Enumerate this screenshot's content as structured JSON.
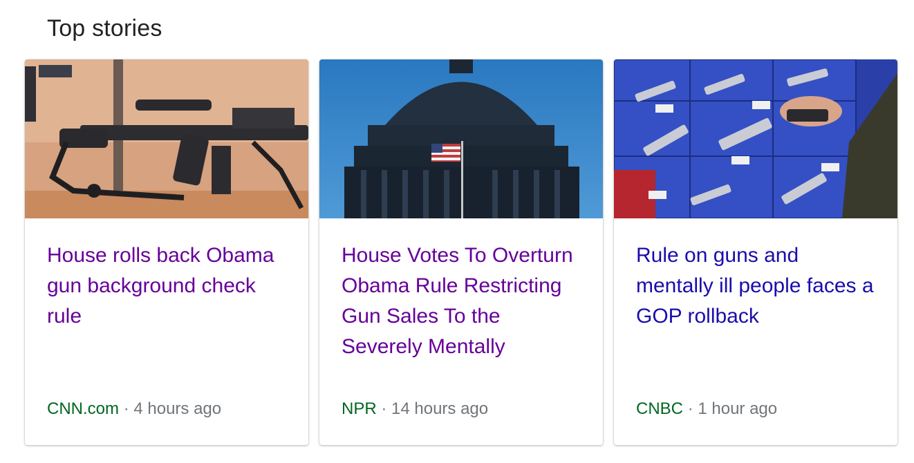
{
  "section": {
    "title": "Top stories"
  },
  "colors": {
    "visited_link": "#660099",
    "link": "#1a0dab",
    "source": "#006621",
    "meta": "#70757a"
  },
  "stories": [
    {
      "headline": "House rolls back Obama gun background check rule",
      "source": "CNN.com",
      "separator": "·",
      "time": "4 hours ago",
      "image_icon": "rifle-photo",
      "visited": true
    },
    {
      "headline": "House Votes To Overturn Obama Rule Restricting Gun Sales To the Severely Mentally",
      "source": "NPR",
      "separator": "·",
      "time": "14 hours ago",
      "image_icon": "capitol-dome-photo",
      "visited": true
    },
    {
      "headline": "Rule on guns and mentally ill people faces a GOP rollback",
      "source": "CNBC",
      "separator": "·",
      "time": "1 hour ago",
      "image_icon": "revolvers-display-photo",
      "visited": false
    }
  ]
}
